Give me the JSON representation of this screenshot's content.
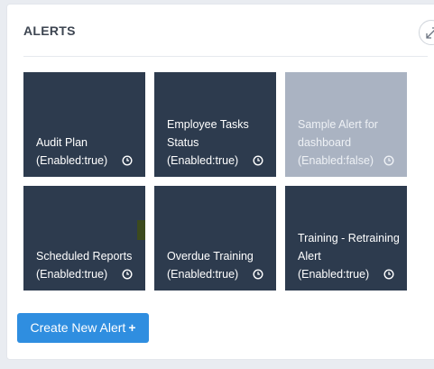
{
  "panel": {
    "title": "ALERTS"
  },
  "alerts": [
    {
      "name": "Audit Plan",
      "status": "(Enabled:true)"
    },
    {
      "name": "Employee Tasks Status",
      "status": "(Enabled:true)"
    },
    {
      "name": "Sample Alert for dashboard",
      "status": "(Enabled:false)"
    },
    {
      "name": "Scheduled Reports",
      "status": "(Enabled:true)"
    },
    {
      "name": "Overdue Training",
      "status": "(Enabled:true)"
    },
    {
      "name": "Training - Retraining Alert",
      "status": "(Enabled:true)"
    }
  ],
  "create_button": {
    "label": "Create New Alert",
    "icon": "+"
  },
  "colors": {
    "tile_enabled": "#2d3b4e",
    "tile_disabled": "#aab3c2",
    "primary_button": "#2f8ee0"
  }
}
